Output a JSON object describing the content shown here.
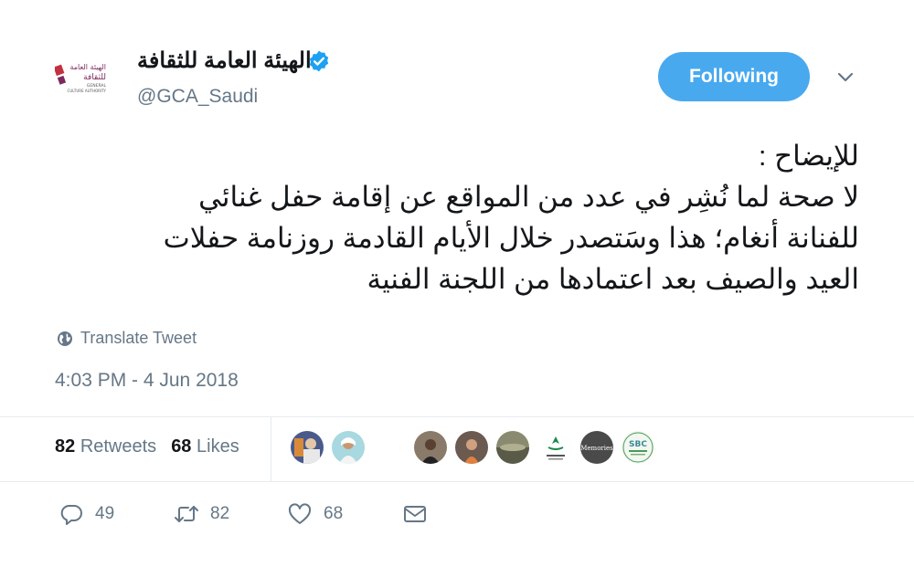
{
  "account": {
    "display_name": "الهيئة العامة للثقافة",
    "handle": "@GCA_Saudi",
    "verified": true,
    "logo_text_ar_1": "الهيئة العامة",
    "logo_text_ar_2": "للثقافة",
    "logo_text_en_1": "GENERAL",
    "logo_text_en_2": "CULTURE AUTHORITY"
  },
  "follow_button": {
    "label": "Following"
  },
  "tweet": {
    "lines": [
      "للإيضاح :",
      " لا صحة لما نُشِر في عدد من المواقع  عن إقامة حفل غنائي",
      "للفنانة أنغام؛ هذا وسَتصدر خلال الأيام القادمة روزنامة حفلات",
      "العيد والصيف بعد اعتمادها من اللجنة الفنية"
    ],
    "translate_label": "Translate Tweet",
    "timestamp": "4:03 PM - 4 Jun 2018"
  },
  "stats": {
    "retweets_count": "82",
    "retweets_label": "Retweets",
    "likes_count": "68",
    "likes_label": "Likes"
  },
  "avatar_labels": {
    "memories": "Memories",
    "sbc": "SBC"
  },
  "actions": {
    "replies": "49",
    "retweets": "82",
    "likes": "68"
  },
  "colors": {
    "follow_bg": "#48a9ef",
    "verified": "#1da1f2",
    "secondary_text": "#657786",
    "divider": "#e6ecf0"
  }
}
